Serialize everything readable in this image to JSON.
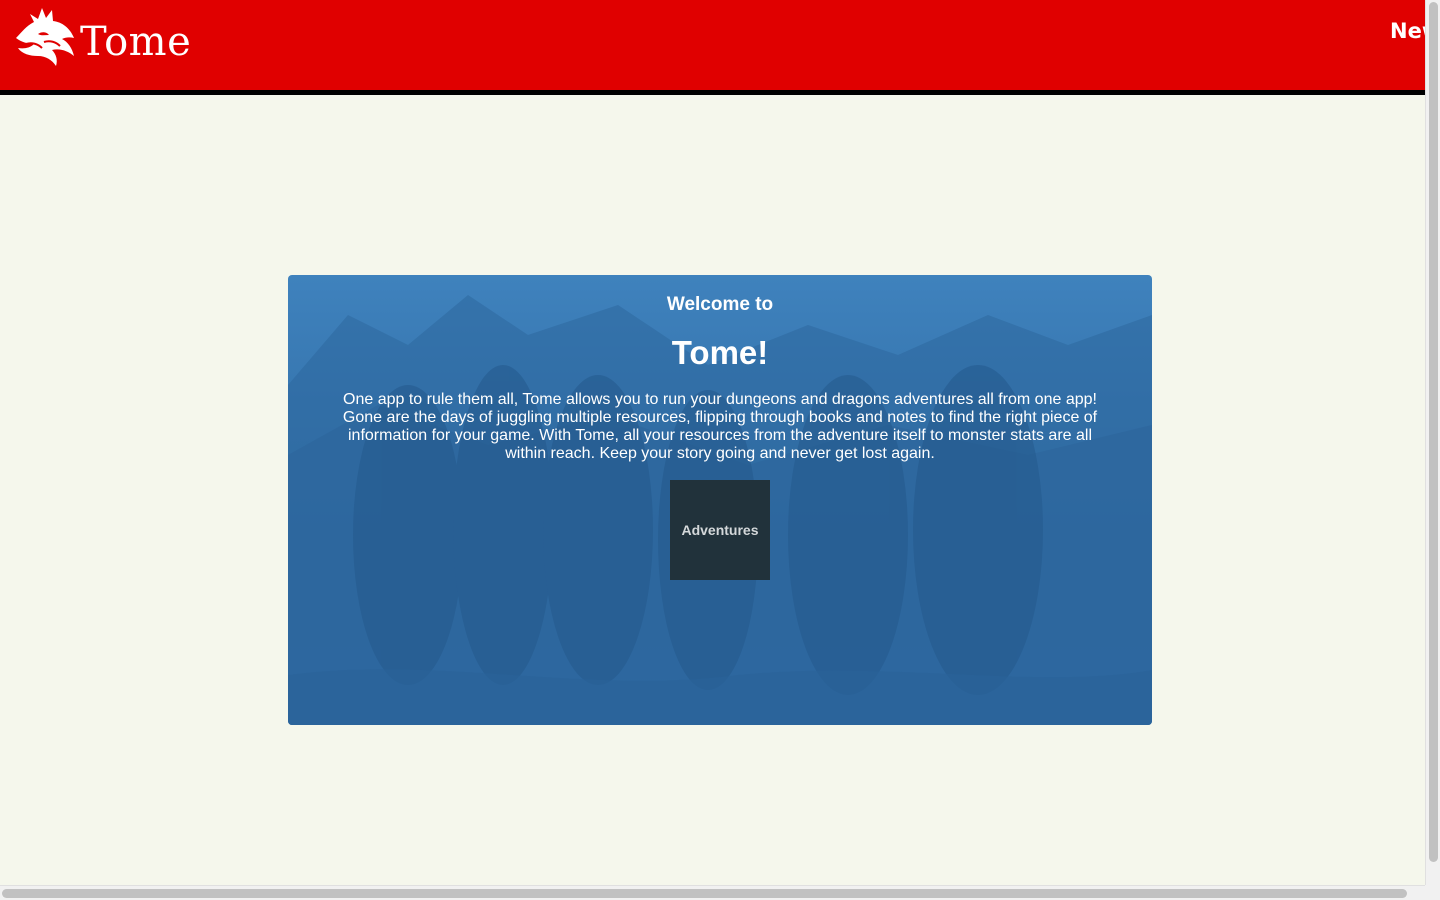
{
  "header": {
    "brand": "Tome",
    "nav_new_label": "New"
  },
  "hero": {
    "welcome": "Welcome to",
    "title": "Tome!",
    "description": "One app to rule them all, Tome allows you to run your dungeons and dragons adventures all from one app! Gone are the days of juggling multiple resources, flipping through books and notes to find the right piece of information for your game. With Tome, all your resources from the adventure itself to monster stats are all within reach. Keep your story going and never get lost again.",
    "button_label": "Adventures"
  },
  "colors": {
    "header_bg": "#e00000",
    "page_bg": "#f5f7ec",
    "hero_bg": "#3574ad",
    "button_bg": "#21323b"
  },
  "icons": {
    "logo": "dragon-head-icon"
  }
}
